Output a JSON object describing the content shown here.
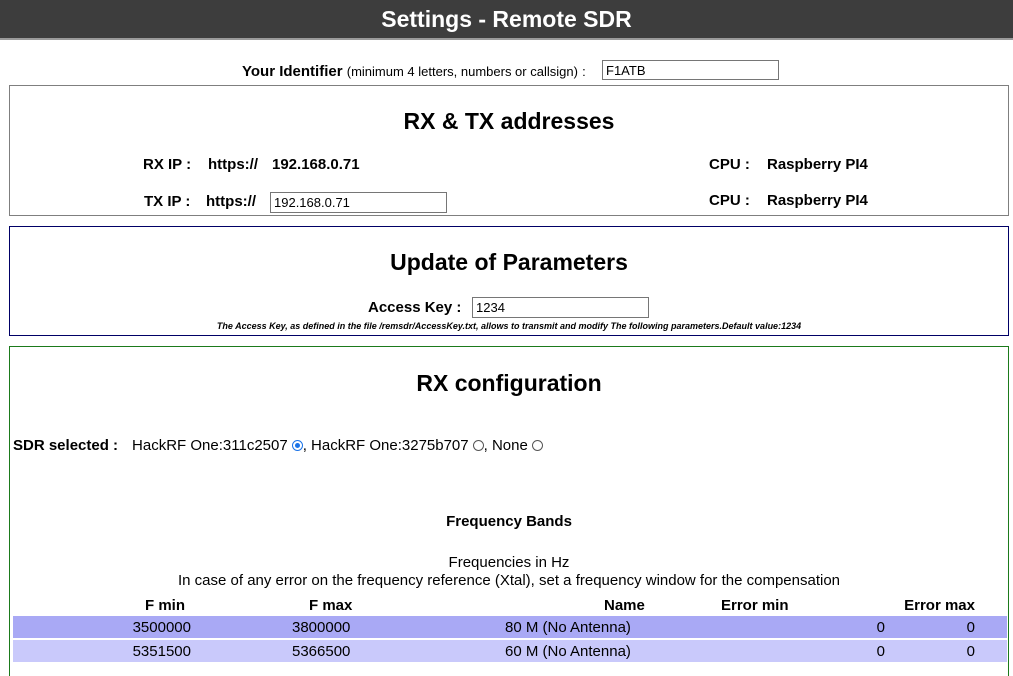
{
  "header": {
    "title": "Settings - Remote SDR"
  },
  "identifier": {
    "label": "Your Identifier",
    "hint": "(minimum 4 letters, numbers or callsign)",
    "separator": ":",
    "value": "F1ATB"
  },
  "rx_tx": {
    "title": "RX & TX addresses",
    "rx_label": "RX IP :",
    "rx_protocol": "https://",
    "rx_ip": "192.168.0.71",
    "rx_cpu_label": "CPU :",
    "rx_cpu": "Raspberry PI4",
    "tx_label": "TX IP :",
    "tx_protocol": "https://",
    "tx_ip": "192.168.0.71",
    "tx_cpu_label": "CPU :",
    "tx_cpu": "Raspberry PI4"
  },
  "update": {
    "title": "Update of Parameters",
    "access_key_label": "Access Key :",
    "access_key_value": "1234",
    "note": "The Access Key, as defined in the file /remsdr/AccessKey.txt, allows to transmit and modify The following parameters.Default value:1234"
  },
  "rx_config": {
    "title": "RX configuration",
    "sdr_label": "SDR selected :",
    "sdr_options": [
      {
        "label": "HackRF One:311c2507",
        "selected": true
      },
      {
        "label": ", HackRF One:3275b707",
        "selected": false
      },
      {
        "label": ", None",
        "selected": false
      }
    ],
    "bands_title": "Frequency Bands",
    "freq_unit_text": "Frequencies in Hz",
    "compensation_text": "In case of any error on the frequency reference (Xtal), set a frequency window for the compensation",
    "columns": [
      "F min",
      "F max",
      "Name",
      "Error min",
      "Error max"
    ],
    "rows": [
      [
        "3500000",
        "3800000",
        "80 M (No Antenna)",
        "0",
        "0"
      ],
      [
        "5351500",
        "5366500",
        "60 M (No Antenna)",
        "0",
        "0"
      ]
    ]
  },
  "colors": {
    "header_bg": "#3d3d3d",
    "row_a": "#a9a9f5",
    "row_b": "#c9c9fb",
    "rxconf_border": "#1b7a1b",
    "update_border": "#000066"
  }
}
